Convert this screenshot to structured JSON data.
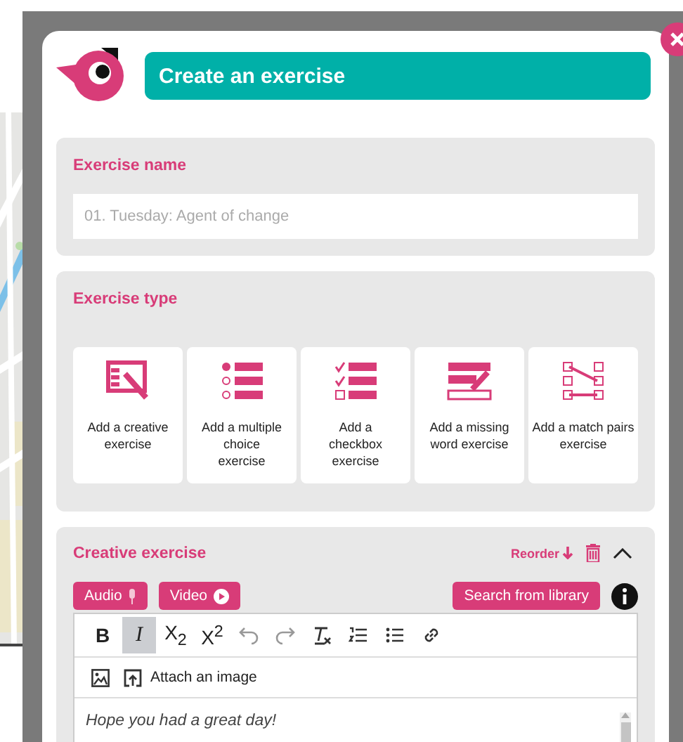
{
  "header": {
    "title": "Create an exercise"
  },
  "name_section": {
    "label": "Exercise name",
    "placeholder": "01. Tuesday: Agent of change"
  },
  "type_section": {
    "label": "Exercise type",
    "options": [
      {
        "kind": "creative",
        "label": "Add a creative exercise"
      },
      {
        "kind": "multiple",
        "label": "Add a multiple choice exercise"
      },
      {
        "kind": "checkbox",
        "label": "Add a checkbox exercise"
      },
      {
        "kind": "missing",
        "label": "Add a missing word exercise"
      },
      {
        "kind": "match",
        "label": "Add a match pairs exercise"
      }
    ]
  },
  "creative_section": {
    "title": "Creative exercise",
    "reorder": "Reorder",
    "expanded": true,
    "media_buttons": [
      {
        "kind": "audio",
        "label": "Audio"
      },
      {
        "kind": "video",
        "label": "Video"
      }
    ],
    "library_button": "Search from library",
    "toolbar": [
      {
        "kind": "bold",
        "label": "B",
        "selected": false
      },
      {
        "kind": "italic",
        "label": "I",
        "selected": true
      },
      {
        "kind": "subscript",
        "label": "X$_{2}$",
        "selected": false
      },
      {
        "kind": "superscript",
        "label": "X$^{2}$",
        "selected": false
      },
      {
        "kind": "undo",
        "selected": false
      },
      {
        "kind": "redo",
        "selected": false
      },
      {
        "kind": "clear",
        "selected": false
      },
      {
        "kind": "ordered",
        "selected": false
      },
      {
        "kind": "bullet",
        "selected": false
      },
      {
        "kind": "link",
        "selected": false
      }
    ],
    "attach_label": "Attach an image",
    "content": "Hope you had a great day!"
  }
}
